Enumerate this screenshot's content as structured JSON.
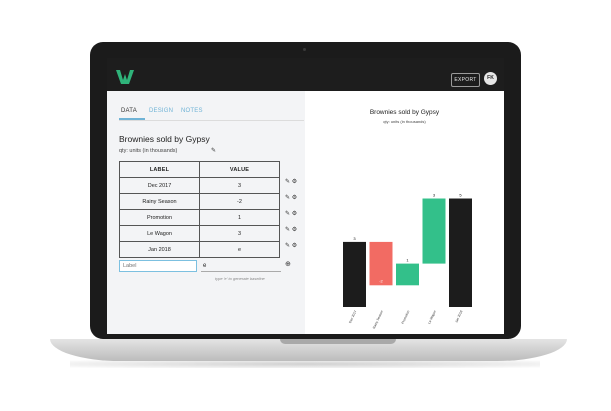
{
  "app": {
    "export_label": "EXPORT",
    "avatar_initials": "FK",
    "brand_color": "#2fb37a"
  },
  "tabs": [
    {
      "label": "DATA",
      "active": true
    },
    {
      "label": "DESIGN",
      "active": false
    },
    {
      "label": "NOTES",
      "active": false
    }
  ],
  "editor": {
    "chart_title": "Brownies sold by Gypsy",
    "chart_subtitle": "qty: units (in thousands)",
    "columns": [
      "LABEL",
      "VALUE"
    ],
    "rows": [
      {
        "label": "Dec 2017",
        "value": "3"
      },
      {
        "label": "Rainy Season",
        "value": "-2"
      },
      {
        "label": "Promotion",
        "value": "1"
      },
      {
        "label": "Le Wagon",
        "value": "3"
      },
      {
        "label": "Jan 2018",
        "value": "e"
      }
    ],
    "new_label_placeholder": "Label",
    "new_value": "e",
    "hint": "type 'e' to generate baseline",
    "icons": [
      "pencil-icon",
      "gear-icon",
      "plus-circle-icon"
    ]
  },
  "chart_data": {
    "type": "bar",
    "subtype": "waterfall",
    "title": "Brownies sold by Gypsy",
    "subtitle": "qty: units (in thousands)",
    "categories": [
      "Dec 2017",
      "Rainy Season",
      "Promotion",
      "Le Wagon",
      "Jan 2018"
    ],
    "values": [
      3,
      -2,
      1,
      3,
      5
    ],
    "kinds": [
      "total",
      "delta",
      "delta",
      "delta",
      "total"
    ],
    "data_labels": [
      "3",
      "-2",
      "1",
      "3",
      "5"
    ],
    "ylim": [
      0,
      5.3
    ],
    "colors": {
      "total": "#1c1c1c",
      "negative": "#f26b63",
      "positive": "#33c08a"
    },
    "grid": false,
    "legend": "none"
  }
}
